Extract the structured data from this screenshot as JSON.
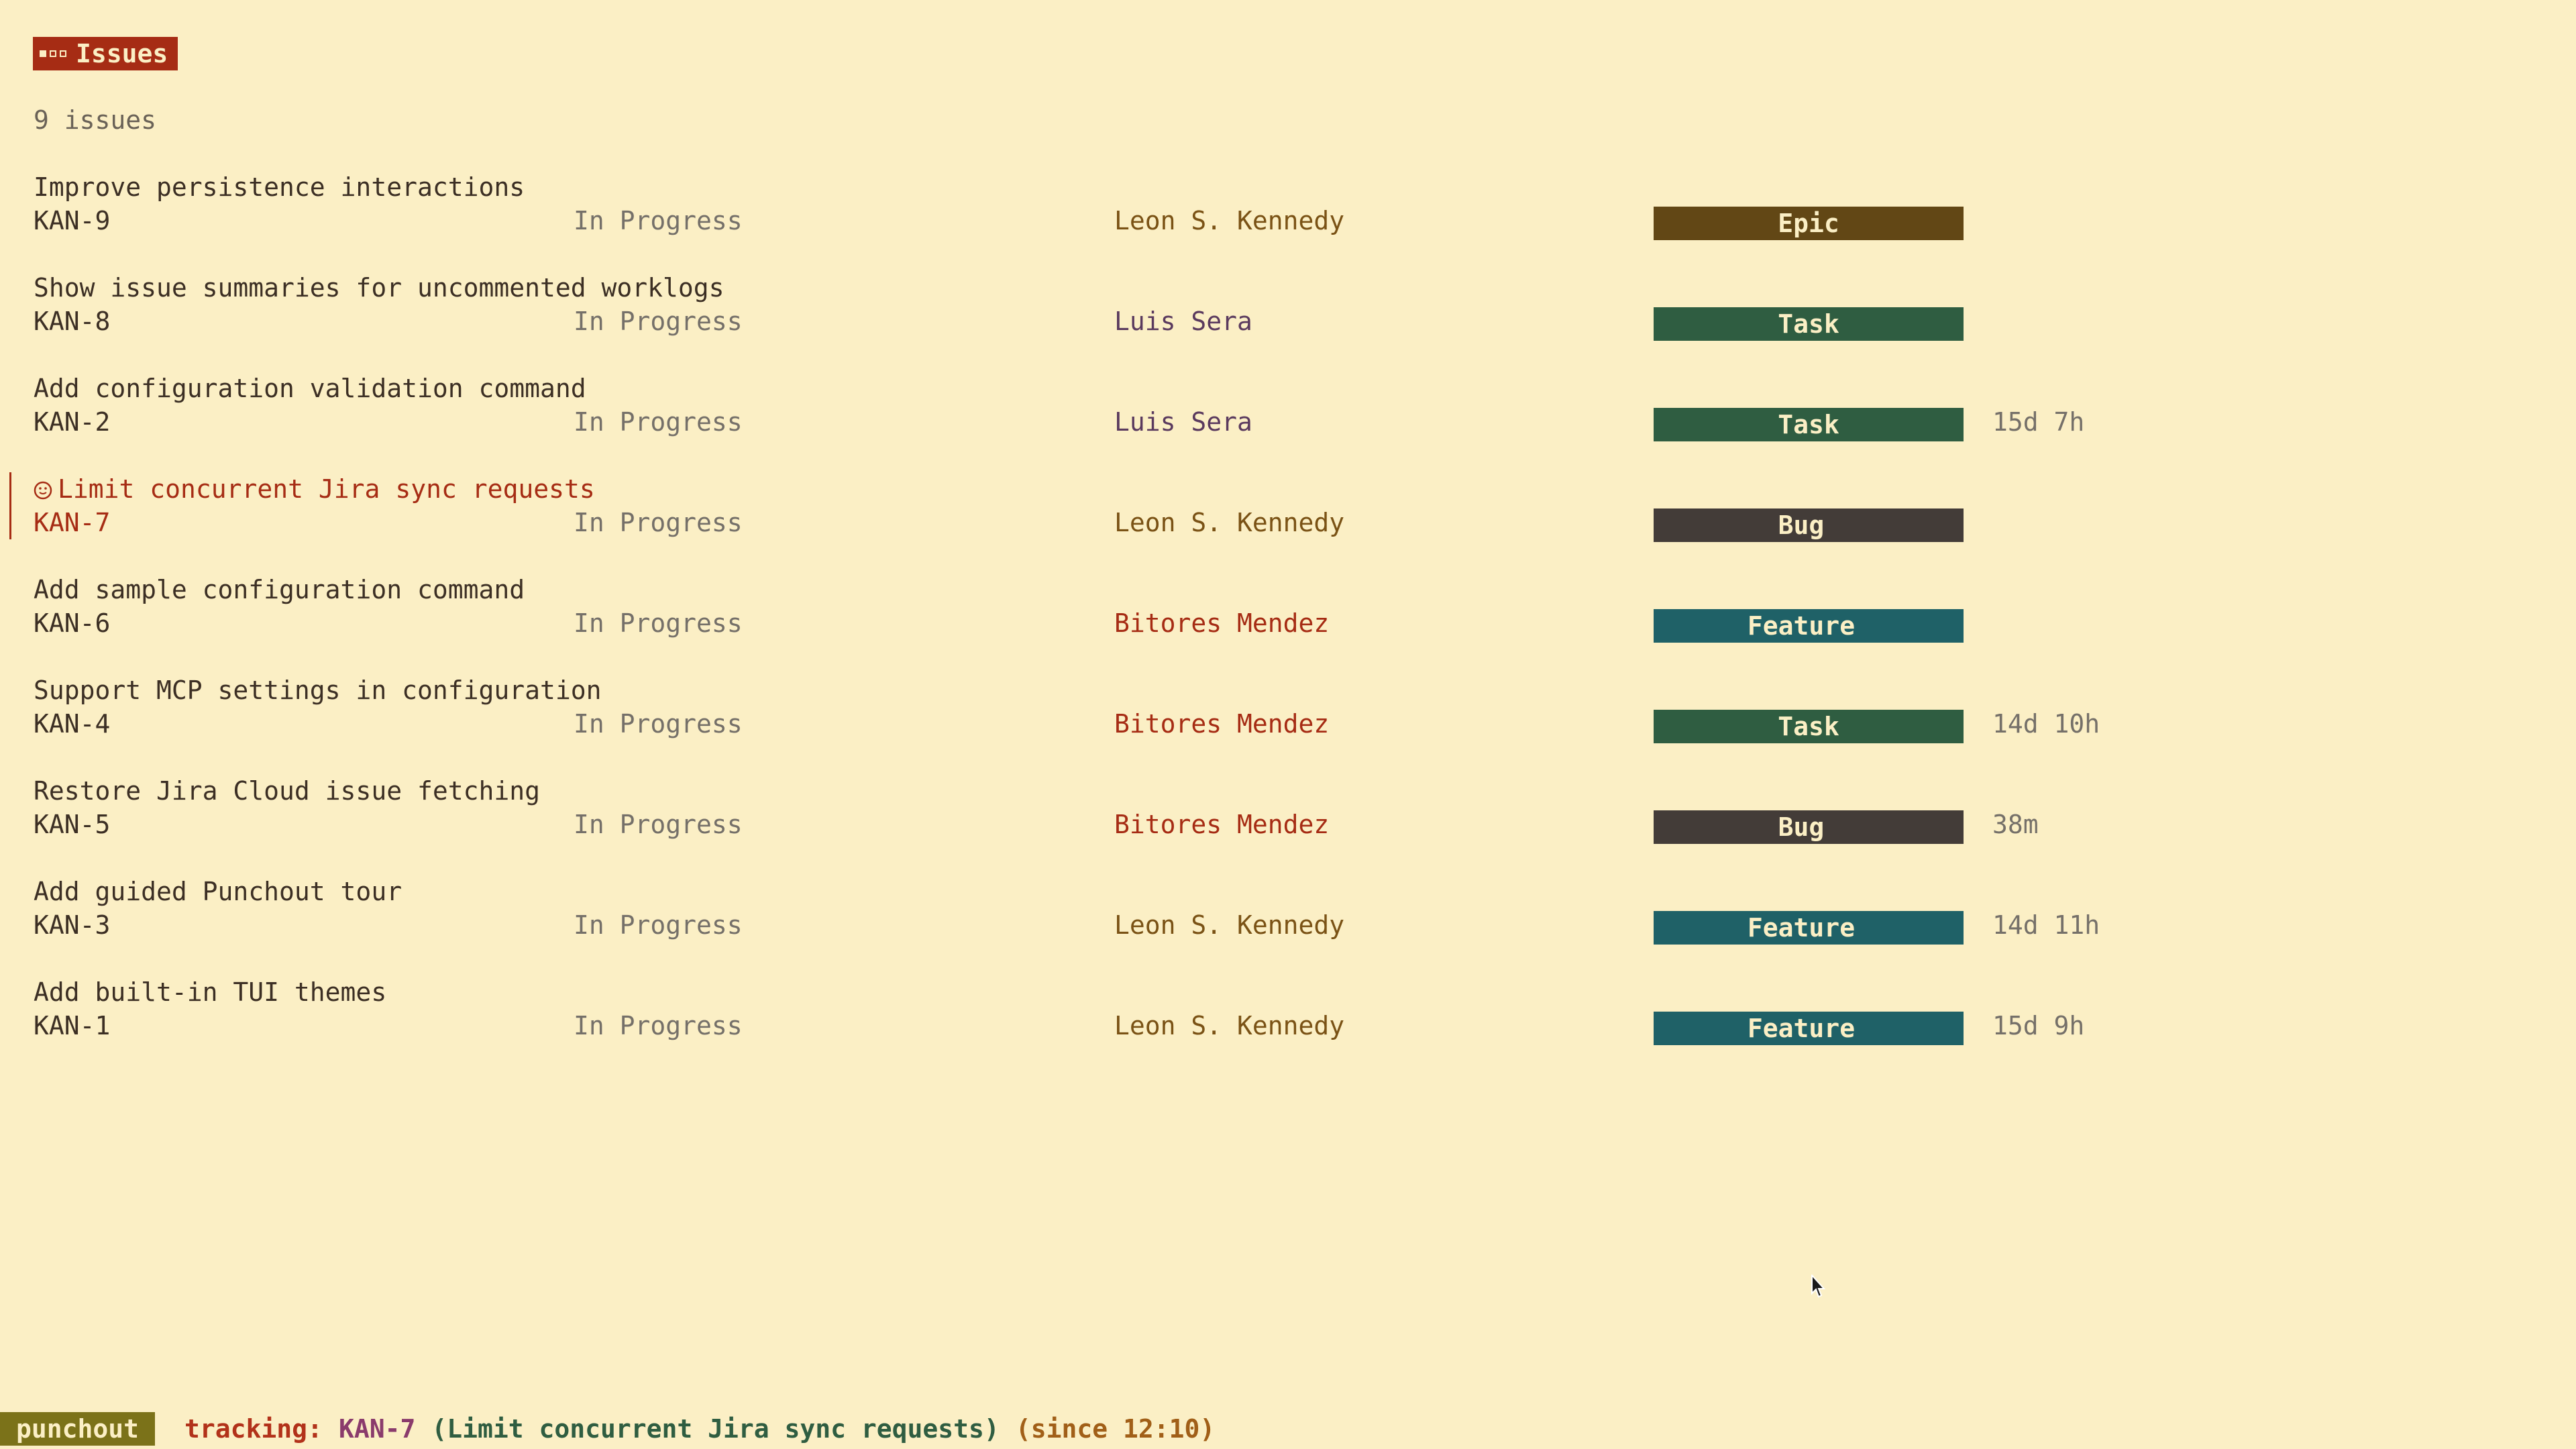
{
  "header": {
    "title": "Issues"
  },
  "issue_count": "9 issues",
  "issues": [
    {
      "summary": "Improve persistence interactions",
      "key": "KAN-9",
      "status": "In Progress",
      "assignee": "Leon S. Kennedy",
      "type": "Epic",
      "worked": ""
    },
    {
      "summary": "Show issue summaries for uncommented worklogs",
      "key": "KAN-8",
      "status": "In Progress",
      "assignee": "Luis Sera",
      "type": "Task",
      "worked": ""
    },
    {
      "summary": "Add configuration validation command",
      "key": "KAN-2",
      "status": "In Progress",
      "assignee": "Luis Sera",
      "type": "Task",
      "worked": "15d 7h"
    },
    {
      "summary": "Limit concurrent Jira sync requests",
      "key": "KAN-7",
      "status": "In Progress",
      "assignee": "Leon S. Kennedy",
      "type": "Bug",
      "worked": ""
    },
    {
      "summary": "Add sample configuration command",
      "key": "KAN-6",
      "status": "In Progress",
      "assignee": "Bitores Mendez",
      "type": "Feature",
      "worked": ""
    },
    {
      "summary": "Support MCP settings in configuration",
      "key": "KAN-4",
      "status": "In Progress",
      "assignee": "Bitores Mendez",
      "type": "Task",
      "worked": "14d 10h"
    },
    {
      "summary": "Restore Jira Cloud issue fetching",
      "key": "KAN-5",
      "status": "In Progress",
      "assignee": "Bitores Mendez",
      "type": "Bug",
      "worked": "38m"
    },
    {
      "summary": "Add guided Punchout tour",
      "key": "KAN-3",
      "status": "In Progress",
      "assignee": "Leon S. Kennedy",
      "type": "Feature",
      "worked": "14d 11h"
    },
    {
      "summary": "Add built-in TUI themes",
      "key": "KAN-1",
      "status": "In Progress",
      "assignee": "Leon S. Kennedy",
      "type": "Feature",
      "worked": "15d 9h"
    }
  ],
  "statusbar": {
    "app_name": "punchout",
    "tracking_label": "tracking:",
    "tracking_key": "KAN-7",
    "tracking_summary": "(Limit concurrent Jira sync requests)",
    "tracking_since": "(since 12:10)"
  },
  "colors": {
    "background": "#fbefc5",
    "accent": "#a62c14",
    "epic": "#624715",
    "task": "#2f5d41",
    "bug": "#433c38",
    "feature": "#1f6167"
  }
}
